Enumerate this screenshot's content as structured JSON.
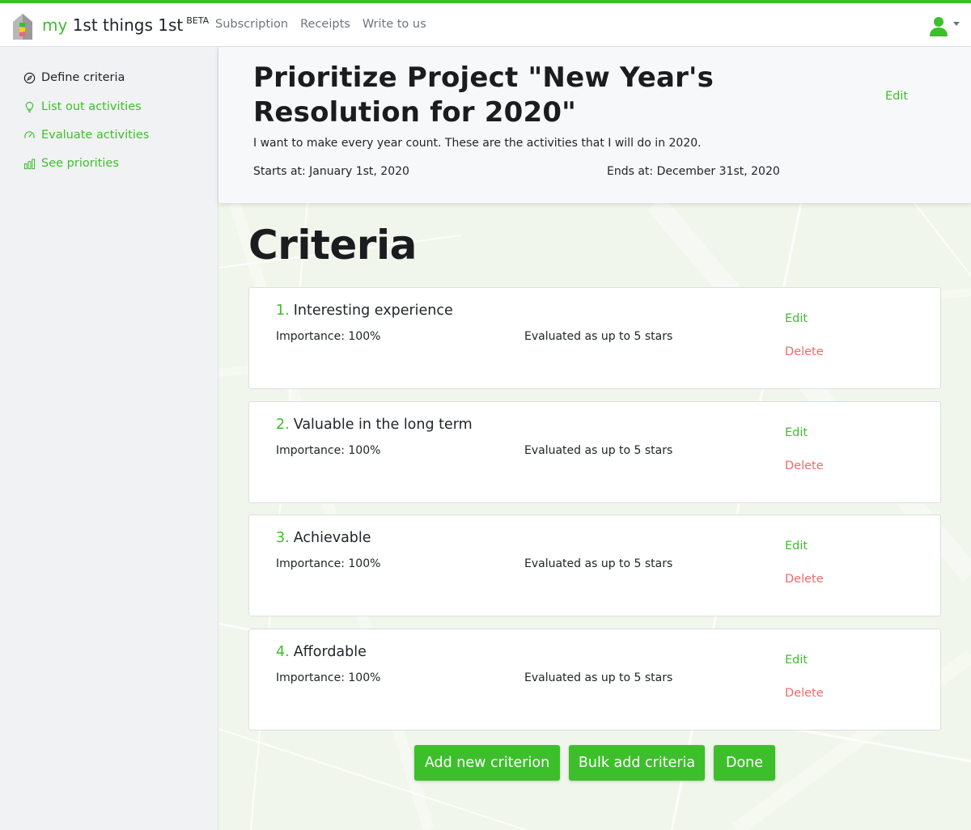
{
  "brand": {
    "prefix": "my",
    "name": "1st things 1st",
    "badge": "BETA"
  },
  "nav": {
    "links": [
      "Subscription",
      "Receipts",
      "Write to us"
    ]
  },
  "sidebar": {
    "items": [
      {
        "label": "Define criteria",
        "icon": "compass-icon",
        "active": true
      },
      {
        "label": "List out activities",
        "icon": "lightbulb-icon",
        "active": false
      },
      {
        "label": "Evaluate activities",
        "icon": "gauge-icon",
        "active": false
      },
      {
        "label": "See priorities",
        "icon": "bar-chart-icon",
        "active": false
      }
    ]
  },
  "project": {
    "title": "Prioritize Project \"New Year's Resolution for 2020\"",
    "edit_label": "Edit",
    "description": "I want to make every year count. These are the activities that I will do in 2020.",
    "starts": "Starts at: January 1st, 2020",
    "ends": "Ends at: December 31st, 2020"
  },
  "criteria": {
    "heading": "Criteria",
    "items": [
      {
        "num": "1.",
        "name": "Interesting experience",
        "importance": "Importance: 100%",
        "evaluation": "Evaluated as up to 5 stars",
        "edit": "Edit",
        "delete": "Delete"
      },
      {
        "num": "2.",
        "name": "Valuable in the long term",
        "importance": "Importance: 100%",
        "evaluation": "Evaluated as up to 5 stars",
        "edit": "Edit",
        "delete": "Delete"
      },
      {
        "num": "3.",
        "name": "Achievable",
        "importance": "Importance: 100%",
        "evaluation": "Evaluated as up to 5 stars",
        "edit": "Edit",
        "delete": "Delete"
      },
      {
        "num": "4.",
        "name": "Affordable",
        "importance": "Importance: 100%",
        "evaluation": "Evaluated as up to 5 stars",
        "edit": "Edit",
        "delete": "Delete"
      }
    ]
  },
  "actions": {
    "add": "Add new criterion",
    "bulk": "Bulk add criteria",
    "done": "Done"
  },
  "colors": {
    "accent": "#3dbf2b",
    "danger": "#f36868",
    "sidebar_bg": "#f1f2f4"
  },
  "user": {
    "icon": "user-icon"
  }
}
